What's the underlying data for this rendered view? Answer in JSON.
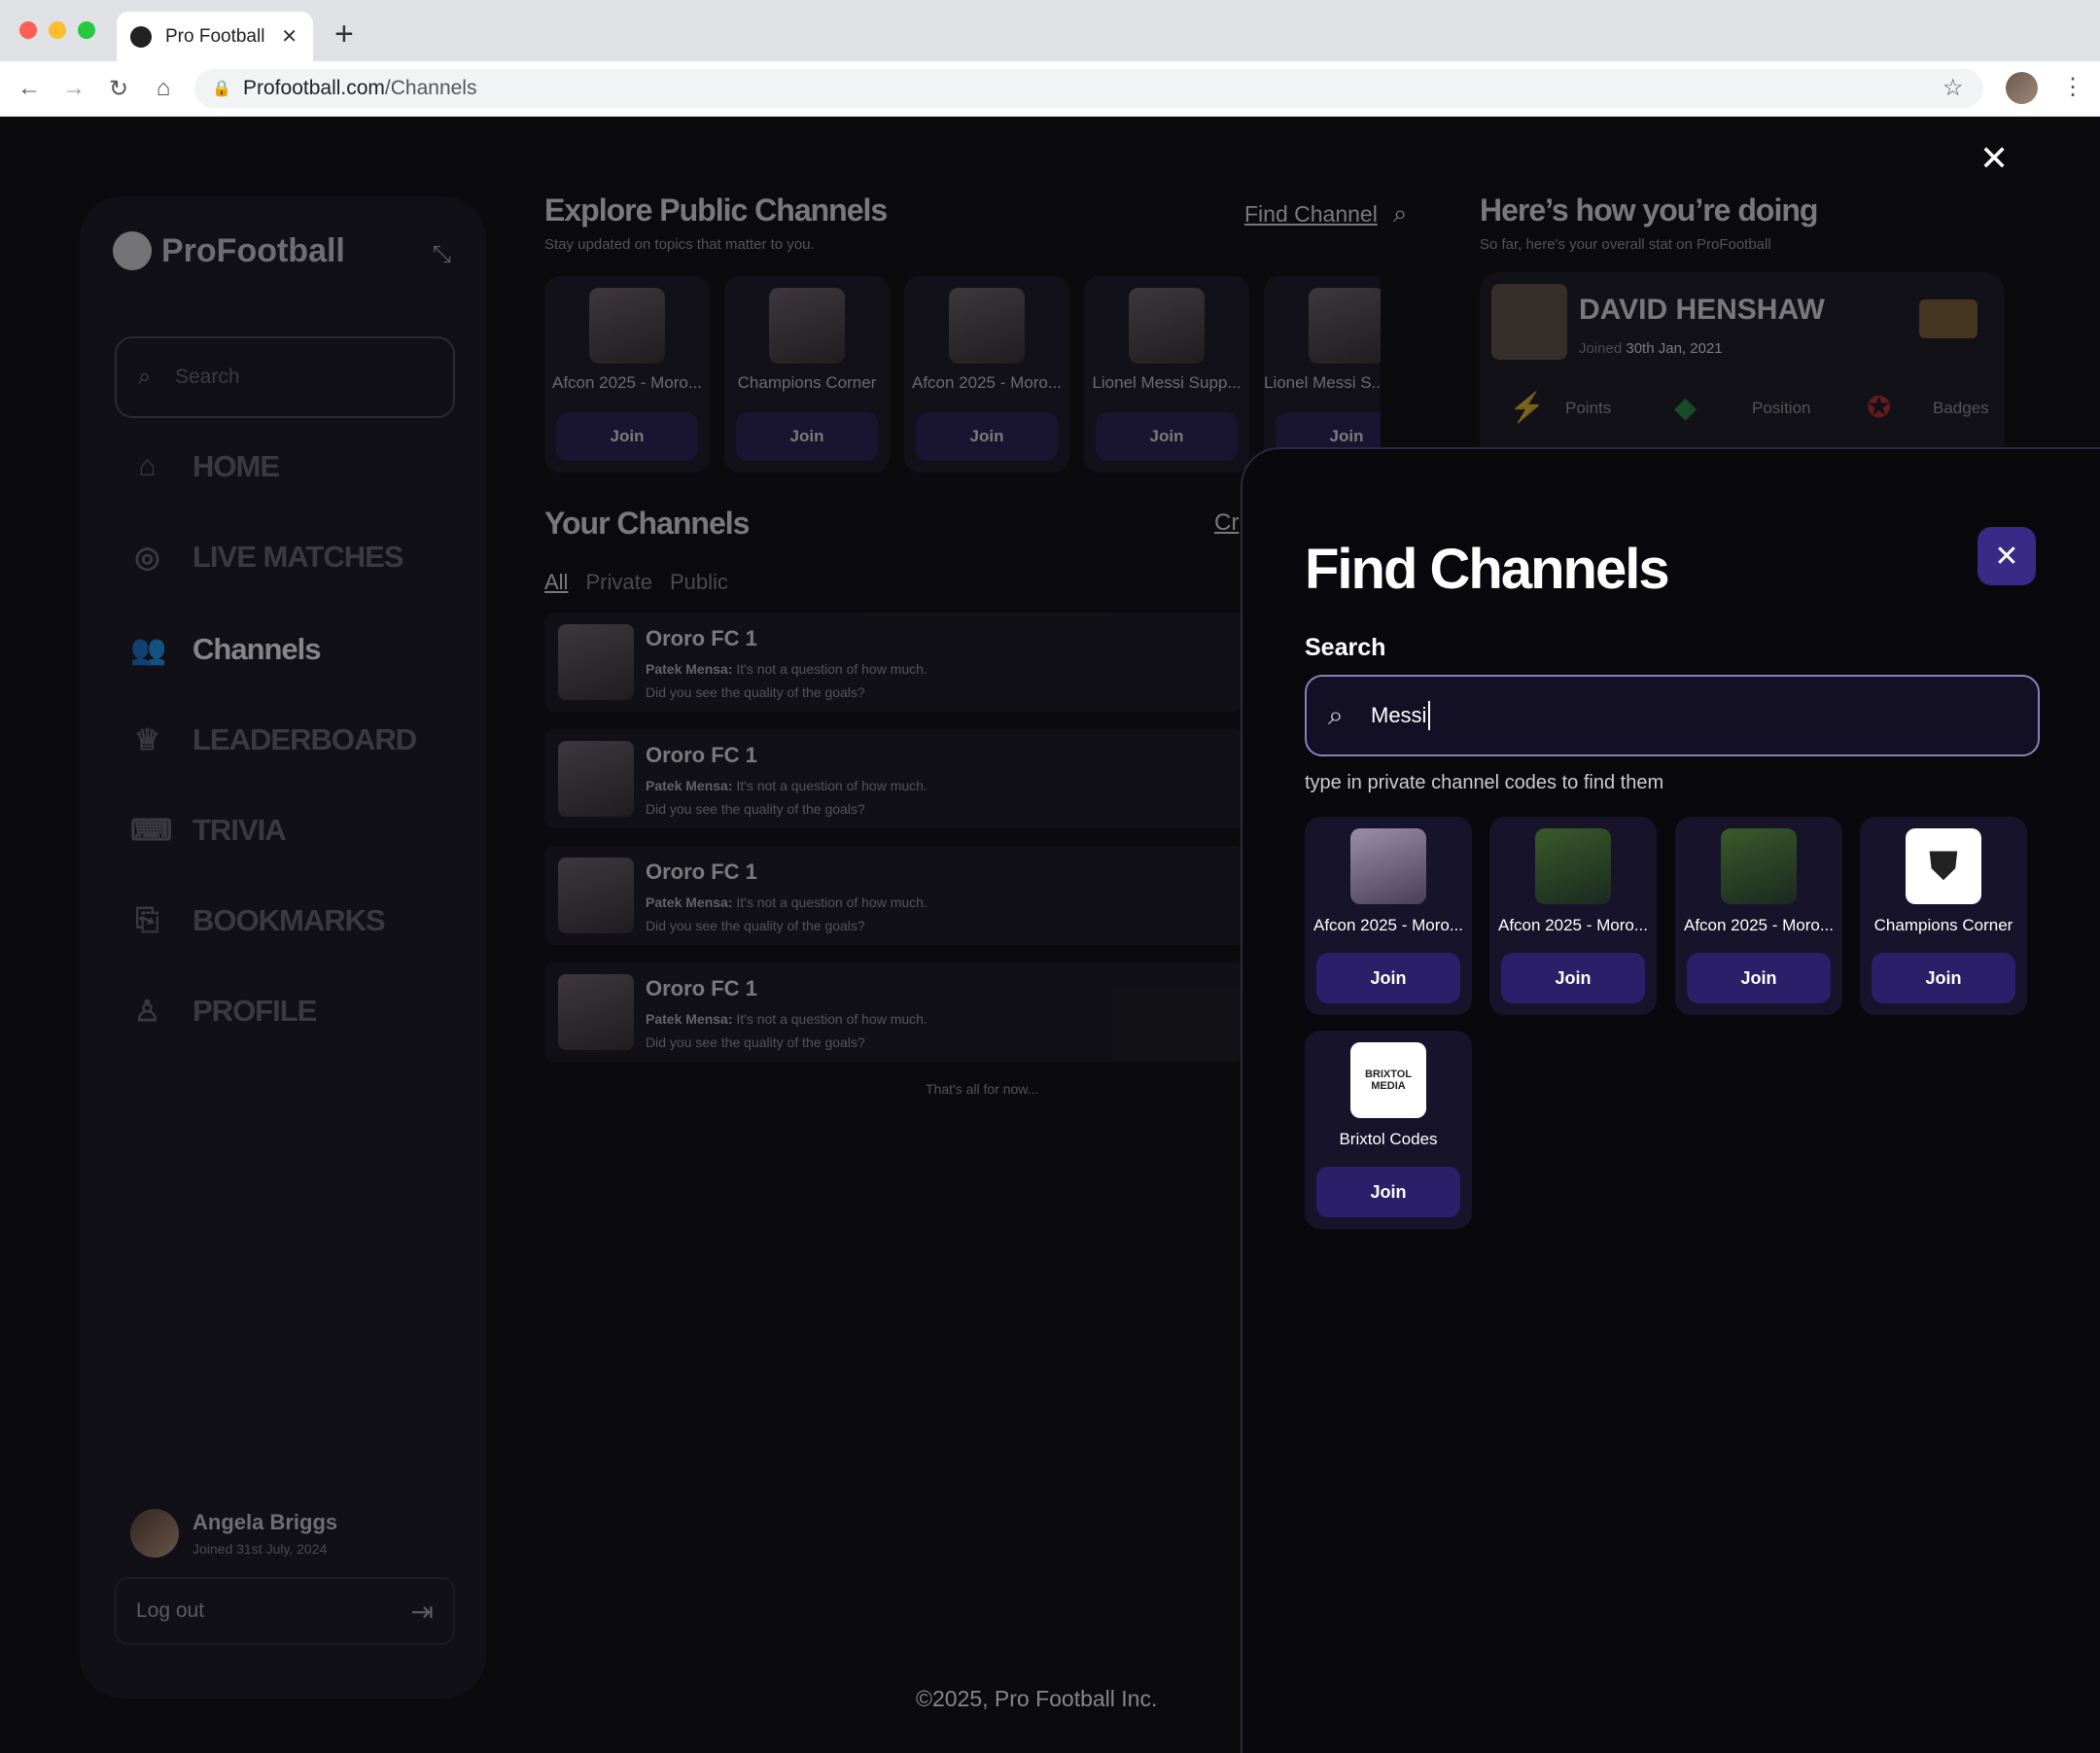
{
  "browser": {
    "tab_title": "Pro Football",
    "url_host": "Profootball.com",
    "url_path": "/Channels"
  },
  "sidebar": {
    "brand": "ProFootball",
    "search_placeholder": "Search",
    "items": [
      {
        "label": "HOME",
        "icon": "home-icon"
      },
      {
        "label": "LIVE MATCHES",
        "icon": "ball-icon"
      },
      {
        "label": "Channels",
        "icon": "users-icon"
      },
      {
        "label": "LEADERBOARD",
        "icon": "trophy-icon"
      },
      {
        "label": "TRIVIA",
        "icon": "gamepad-icon"
      },
      {
        "label": "BOOKMARKS",
        "icon": "bookmark-icon"
      },
      {
        "label": "PROFILE",
        "icon": "user-icon"
      }
    ],
    "user": {
      "name": "Angela Briggs",
      "joined": "Joined 31st July, 2024"
    },
    "logout": "Log out"
  },
  "explore": {
    "title": "Explore Public Channels",
    "subtitle": "Stay updated on topics that matter to you.",
    "find_link": "Find Channel",
    "cards": [
      {
        "title": "Afcon 2025 - Moro...",
        "join": "Join"
      },
      {
        "title": "Champions Corner",
        "join": "Join"
      },
      {
        "title": "Afcon 2025 - Moro...",
        "join": "Join"
      },
      {
        "title": "Lionel Messi Supp...",
        "join": "Join"
      },
      {
        "title": "Lionel Messi S...",
        "join": "Join"
      }
    ]
  },
  "your_channels": {
    "title": "Your Channels",
    "create": "Cr",
    "filters": [
      "All",
      "Private",
      "Public"
    ],
    "rows": [
      {
        "name": "Ororo FC 1",
        "sender": "Patek Mensa:",
        "msg": "It's not a question of how much.",
        "msg2": "Did you see  the quality of the goals?"
      },
      {
        "name": "Ororo FC 1",
        "sender": "Patek Mensa:",
        "msg": "It's not a question of how much.",
        "msg2": "Did you see  the quality of the goals?"
      },
      {
        "name": "Ororo FC 1",
        "sender": "Patek Mensa:",
        "msg": "It's not a question of how much.",
        "msg2": "Did you see  the quality of the goals?"
      },
      {
        "name": "Ororo FC 1",
        "sender": "Patek Mensa:",
        "msg": "It's not a question of how much.",
        "msg2": "Did you see  the quality of the goals?"
      }
    ],
    "end_note": "That's all for now..."
  },
  "stats": {
    "title": "Here’s how you’re doing",
    "subtitle": "So far, here's your overall stat on ProFootball",
    "name": "DAVID HENSHAW",
    "joined_prefix": "Joined",
    "joined_date": "30th Jan, 2021",
    "points_label": "Points",
    "position_label": "Position",
    "badges_label": "Badges"
  },
  "find_panel": {
    "title": "Find Channels",
    "search_label": "Search",
    "search_value": "Messi",
    "hint": "type in private channel codes to find them",
    "results": [
      {
        "title": "Afcon 2025 - Moro...",
        "join": "Join"
      },
      {
        "title": "Afcon 2025 - Moro...",
        "join": "Join"
      },
      {
        "title": "Afcon 2025 - Moro...",
        "join": "Join"
      },
      {
        "title": "Champions Corner",
        "join": "Join"
      },
      {
        "title": "Brixtol Codes",
        "join": "Join",
        "logo_text": "BRIXTOL MEDIA"
      }
    ]
  },
  "footer": "©2025, Pro Football Inc.",
  "colors": {
    "accent": "#3a2a88",
    "button": "#2c1f6a",
    "panel_bg": "#09080d"
  }
}
